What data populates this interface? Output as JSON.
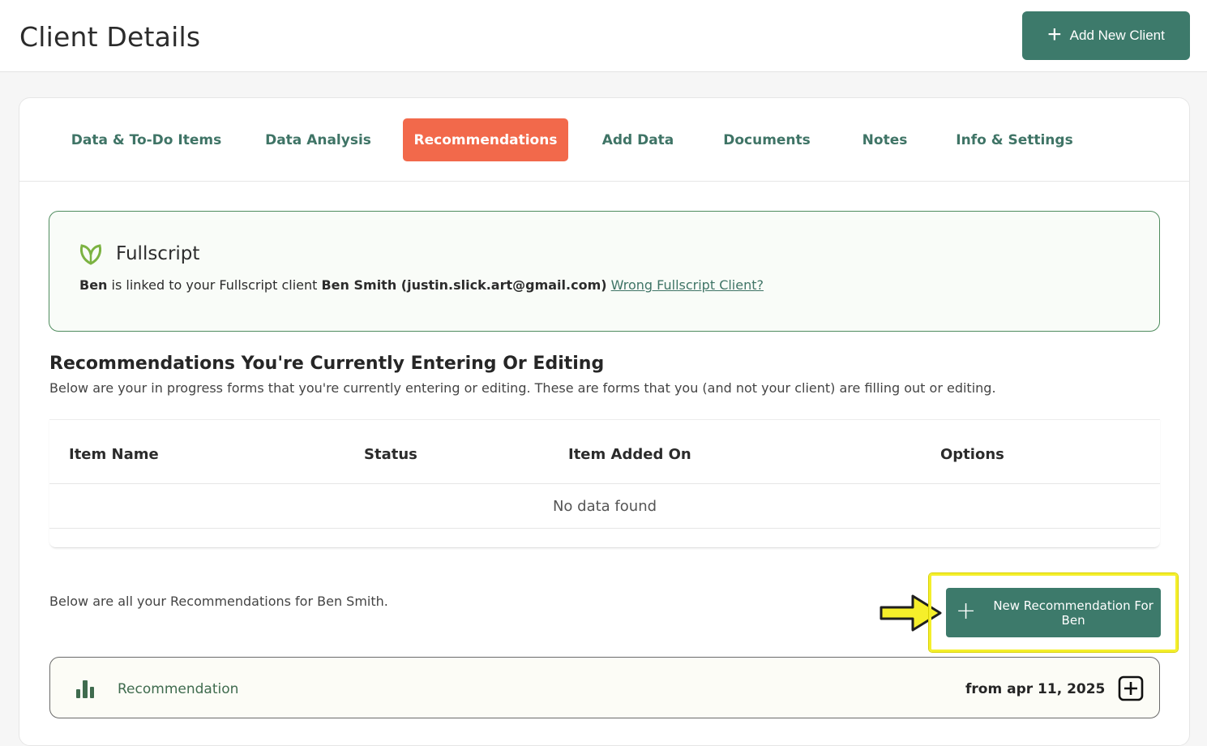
{
  "header": {
    "title": "Client Details",
    "add_client_label": "Add New Client"
  },
  "tabs": [
    {
      "label": "Data & To-Do Items",
      "active": false
    },
    {
      "label": "Data Analysis",
      "active": false
    },
    {
      "label": "Recommendations",
      "active": true
    },
    {
      "label": "Add Data",
      "active": false
    },
    {
      "label": "Documents",
      "active": false
    },
    {
      "label": "Notes",
      "active": false
    },
    {
      "label": "Info & Settings",
      "active": false
    }
  ],
  "fullscript": {
    "name": "Fullscript",
    "client_first": "Ben",
    "linked_text": " is linked to your Fullscript client ",
    "client_full": "Ben Smith (justin.slick.art@gmail.com)",
    "wrong_link": "Wrong Fullscript Client?"
  },
  "in_progress": {
    "title": "Recommendations You're Currently Entering Or Editing",
    "description": "Below are your in progress forms that you're currently entering or editing. These are forms that you (and not your client) are filling out or editing.",
    "columns": [
      "Item Name",
      "Status",
      "Item Added On",
      "Options"
    ],
    "empty_text": "No data found"
  },
  "recommendations": {
    "intro": "Below are all your Recommendations for Ben Smith.",
    "new_button_label": "New Recommendation For Ben",
    "items": [
      {
        "label": "Recommendation",
        "date": "from apr 11, 2025"
      }
    ]
  },
  "colors": {
    "brand_green": "#3d7a6b",
    "active_tab": "#f2694b",
    "highlight": "#f4ef2c"
  }
}
